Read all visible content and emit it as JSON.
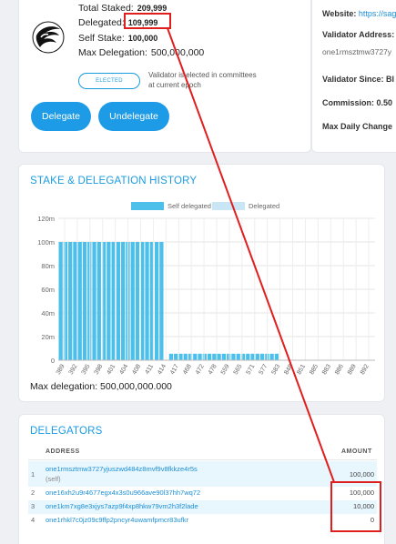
{
  "validator": {
    "total_staked_label": "Total Staked:",
    "total_staked": "209,999",
    "delegated_label": "Delegated:",
    "delegated": "109,999",
    "self_stake_label": "Self Stake:",
    "self_stake": "100,000",
    "max_delegation_label": "Max Delegation:",
    "max_delegation": "500,000,000",
    "status_badge": "ELECTED",
    "status_desc": "Validator is elected in committees at current epoch",
    "delegate_label": "Delegate",
    "undelegate_label": "Undelegate"
  },
  "right_panel": {
    "website_label": "Website:",
    "website_value": "https://sag",
    "address_label": "Validator Address:",
    "address_value": "one1rmsztmw3727y",
    "since_label": "Validator Since: Bl",
    "commission_label": "Commission: 0.50",
    "max_daily_label": "Max Daily Change"
  },
  "chart_section": {
    "title": "STAKE & DELEGATION HISTORY",
    "max_delegation_text": "Max delegation: 500,000,000.000"
  },
  "chart_data": {
    "type": "bar",
    "stacked": true,
    "legend": [
      "Self delegated",
      "Delegated"
    ],
    "legend_position": "top",
    "colors": {
      "self": "#4cc0ea",
      "delegated": "#c9e6f7"
    },
    "y_ticks": [
      "0",
      "20m",
      "40m",
      "60m",
      "80m",
      "100m",
      "120m"
    ],
    "ylim": [
      0,
      120
    ],
    "y_unit": "m",
    "x_tick_labels": [
      "389",
      "392",
      "395",
      "398",
      "401",
      "404",
      "408",
      "411",
      "414",
      "417",
      "468",
      "472",
      "478",
      "559",
      "565",
      "571",
      "577",
      "583",
      "848",
      "851",
      "885",
      "883",
      "886",
      "889",
      "892"
    ],
    "bar_groups": [
      {
        "count": 22,
        "value": 100
      },
      {
        "count": 1,
        "value": 0
      },
      {
        "count": 23,
        "value": 5.5
      },
      {
        "count": 20,
        "value": 0
      }
    ],
    "grid": true
  },
  "delegators": {
    "title": "DELEGATORS",
    "col_address": "ADDRESS",
    "col_amount": "AMOUNT",
    "rows": [
      {
        "num": "1",
        "address": "one1rmsztmw3727yjuszwd484z8mvf9v8fkkze4r5s",
        "note": "(self)",
        "amount": "100,000"
      },
      {
        "num": "2",
        "address": "one16xh2u9r4677egx4x3s0u966ave90l37hh7wq72",
        "amount": "100,000"
      },
      {
        "num": "3",
        "address": "one1km7xg8e3xjys7azp9f4xp8hkw79vm2h3f2lade",
        "amount": "10,000"
      },
      {
        "num": "4",
        "address": "one1rhkl7c0jz09c9ffp2pncyr4uwamfpmcr83ufkr",
        "amount": "0"
      }
    ]
  }
}
